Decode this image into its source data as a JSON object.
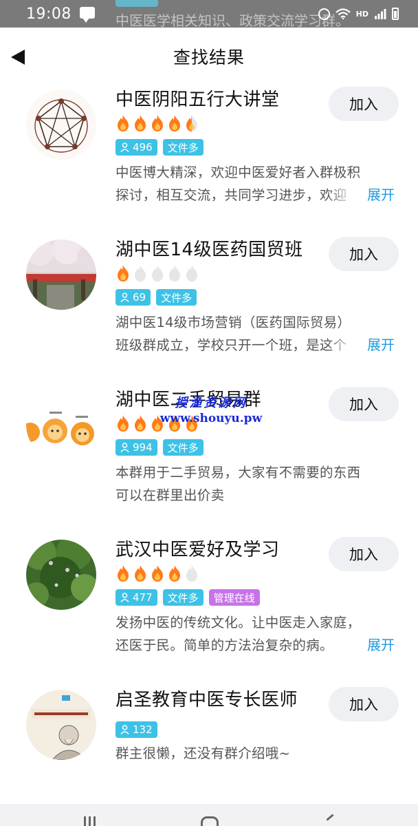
{
  "status_bar": {
    "time": "19:08",
    "network": "HD",
    "background_peek_text": "中医医学相关知识、政策交流学习群。"
  },
  "header": {
    "title": "查找结果",
    "back_icon": "back-arrow-icon"
  },
  "colors": {
    "tag_cyan": "#3dc2e6",
    "tag_purple": "#c673e8",
    "link_blue": "#1e9be0",
    "flame_on": "#ff7a1a",
    "flame_off": "#e6e6e6",
    "join_bg": "#eef0f3"
  },
  "results": [
    {
      "name": "中医阴阳五行大讲堂",
      "activity_rating": 4.5,
      "members": "496",
      "tags": [
        "文件多"
      ],
      "description": "中医博大精深，欢迎中医爱好者入群极积探讨，相互交流，共同学习进步，欢迎",
      "expand_label": "展开",
      "join_label": "加入",
      "avatar": "wuxing-diagram"
    },
    {
      "name": "湖中医14级医药国贸班",
      "activity_rating": 1,
      "members": "69",
      "tags": [
        "文件多"
      ],
      "description": "湖中医14级市场营销（医药国际贸易）班级群成立，学校只开一个班，是这个",
      "expand_label": "展开",
      "join_label": "加入",
      "avatar": "campus-photo"
    },
    {
      "name": "湖中医二手贸易群",
      "activity_rating": 5,
      "members": "994",
      "tags": [
        "文件多"
      ],
      "description": "本群用于二手贸易，大家有不需要的东西可以在群里出价卖",
      "expand_label": "",
      "join_label": "加入",
      "avatar": "cartoon-lions"
    },
    {
      "name": "武汉中医爱好及学习",
      "activity_rating": 4,
      "members": "477",
      "tags": [
        "文件多",
        "管理在线"
      ],
      "description": "发扬中医的传统文化。让中医走入家庭，还医于民。简单的方法治复杂的病。",
      "expand_label": "展开",
      "join_label": "加入",
      "avatar": "tree-photo"
    },
    {
      "name": "启圣教育中医专长医师",
      "activity_rating": null,
      "members": "132",
      "tags": [],
      "description": "群主很懒，还没有群介绍哦~",
      "expand_label": "",
      "join_label": "加入",
      "avatar": "doctor-portrait"
    }
  ],
  "watermark": {
    "line1": "授渔资源网",
    "line2": "www.shouyu.pw"
  }
}
